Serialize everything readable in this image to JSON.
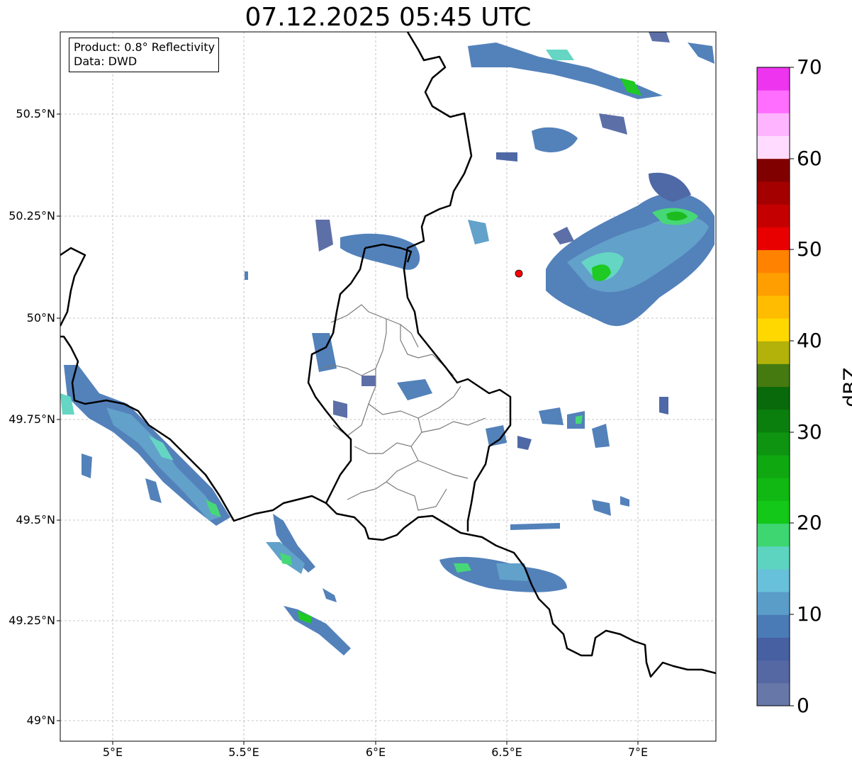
{
  "title": "07.12.2025 05:45 UTC",
  "info": {
    "product": "Product: 0.8° Reflectivity",
    "data": "Data: DWD"
  },
  "lat_ticks": [
    "50.5°N",
    "50.25°N",
    "50°N",
    "49.75°N",
    "49.5°N",
    "49.25°N",
    "49°N"
  ],
  "lon_ticks": [
    "5°E",
    "5.5°E",
    "6°E",
    "6.5°E",
    "7°E"
  ],
  "colorbar": {
    "label": "dBZ",
    "ticks": [
      "70",
      "60",
      "50",
      "40",
      "30",
      "20",
      "10",
      "0"
    ],
    "colors_bottom_to_top": [
      "#6677a8",
      "#5568a3",
      "#4660a2",
      "#4a7bb7",
      "#5a9dc8",
      "#68c1da",
      "#5dd4c0",
      "#3dd670",
      "#13c818",
      "#11b814",
      "#0fa811",
      "#0e9410",
      "#0b7f0e",
      "#096a0b",
      "#457a10",
      "#b2b20a",
      "#ffd800",
      "#ffbc00",
      "#ff9e00",
      "#ff8200",
      "#e80000",
      "#c40000",
      "#a40000",
      "#800000",
      "#ffdcff",
      "#ffb4ff",
      "#ff6eff",
      "#ee34ee"
    ]
  },
  "radar_site": {
    "lon": 6.55,
    "lat": 50.11,
    "color": "#ff0000"
  }
}
